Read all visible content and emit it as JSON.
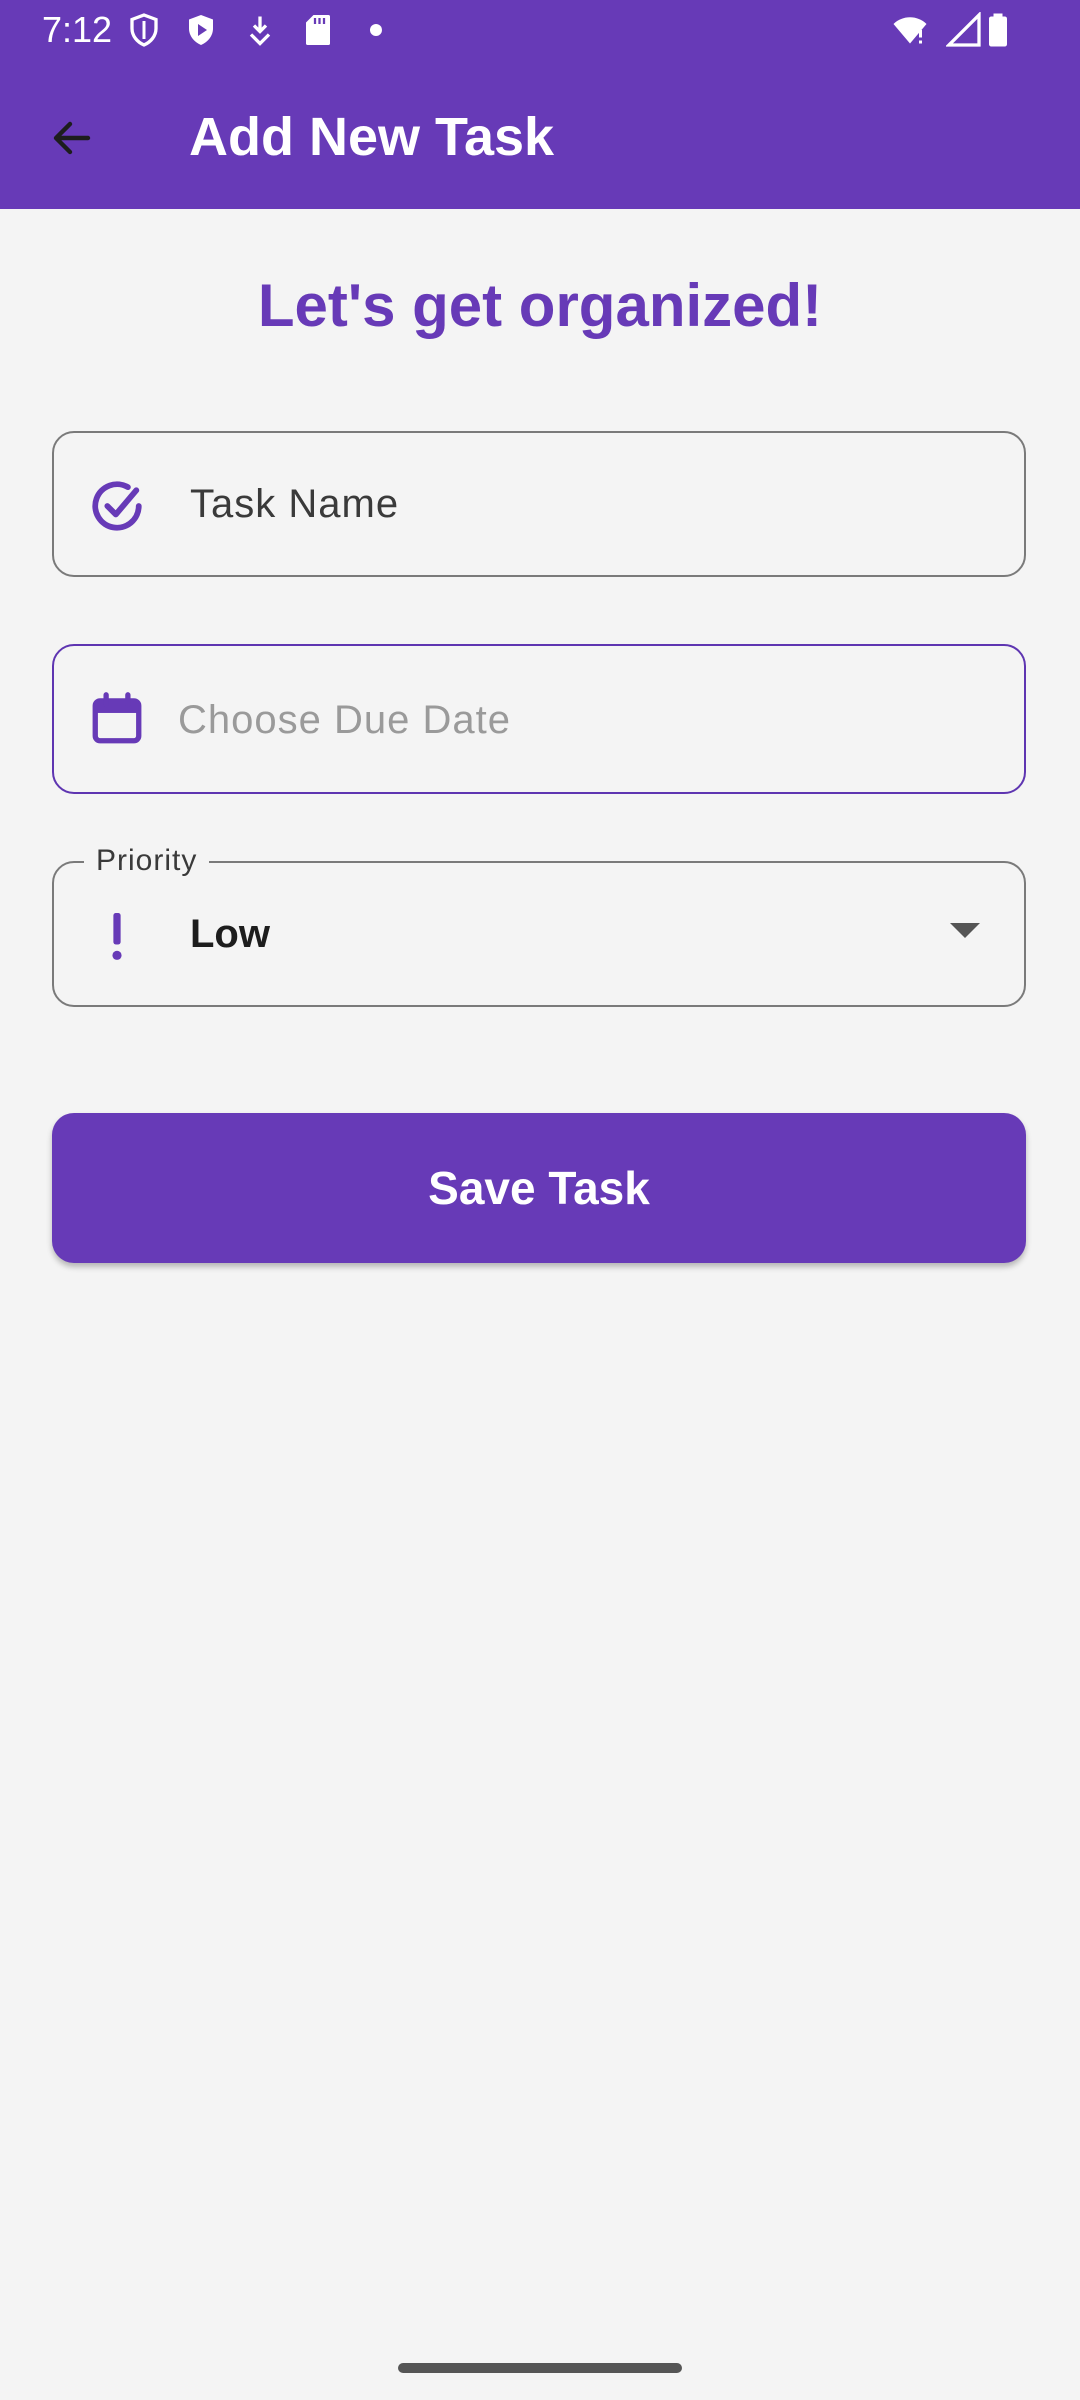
{
  "status_bar": {
    "time": "7:12",
    "left_icons": [
      "shield-outline-icon",
      "play-shield-icon",
      "download-icon",
      "sd-card-icon",
      "dot-icon"
    ],
    "right_icons": [
      "wifi-alert-icon",
      "signal-icon",
      "battery-icon"
    ]
  },
  "app_bar": {
    "back_icon": "arrow-back-icon",
    "title": "Add New Task"
  },
  "heading": "Let's get organized!",
  "form": {
    "task_name": {
      "icon": "check-circle-icon",
      "placeholder": "Task Name"
    },
    "due_date": {
      "icon": "calendar-icon",
      "placeholder": "Choose Due Date"
    },
    "priority": {
      "icon": "exclamation-icon",
      "label": "Priority",
      "value": "Low"
    },
    "save_label": "Save Task"
  },
  "colors": {
    "primary": "#673ab7",
    "background": "#f4f4f4",
    "outline": "#7a7a7a",
    "focus_outline": "#5e35b1"
  }
}
